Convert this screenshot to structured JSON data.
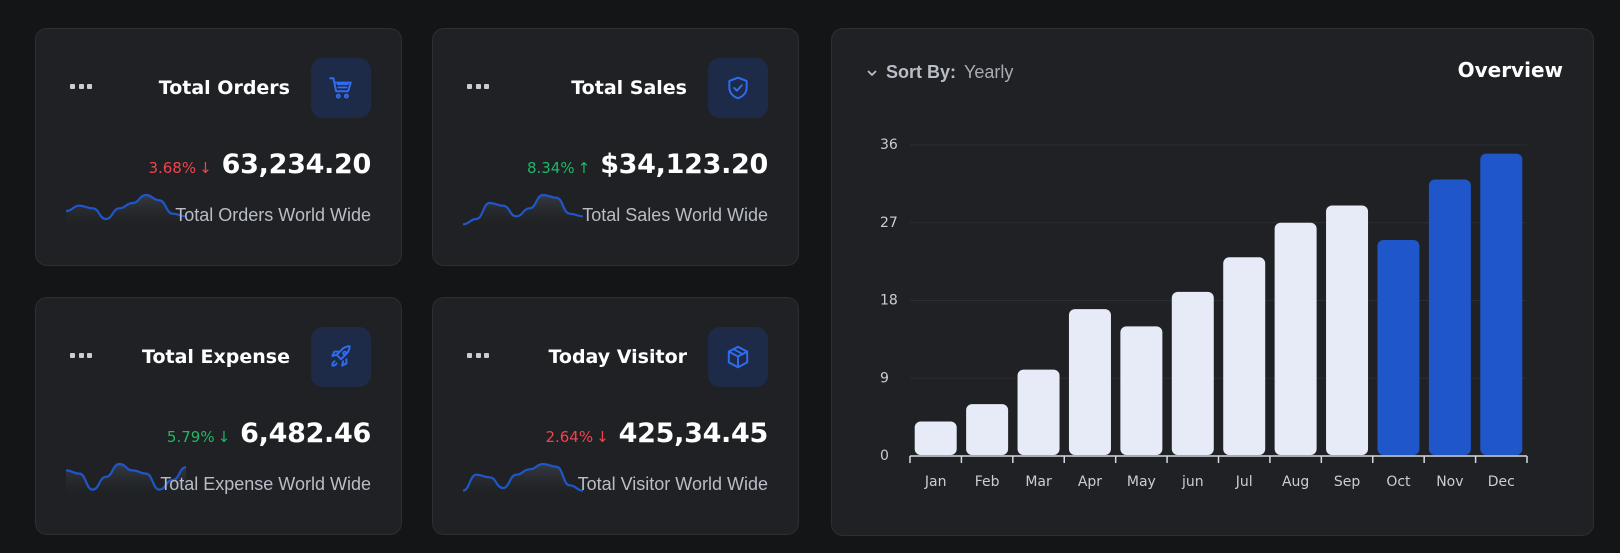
{
  "cards": [
    {
      "title": "Total Orders",
      "icon": "cart-icon",
      "percent": "3.68%",
      "trend": "down",
      "trend_arrow": "↓",
      "value": "63,234.20",
      "subtitle": "Total Orders World Wide",
      "trend_color": "#f1434d",
      "sparkline": [
        6,
        8,
        7,
        3,
        7,
        9,
        12,
        10,
        5,
        4
      ]
    },
    {
      "title": "Total Sales",
      "icon": "shield-check-icon",
      "percent": "8.34%",
      "trend": "up",
      "trend_arrow": "↑",
      "value": "$34,123.20",
      "subtitle": "Total Sales World Wide",
      "trend_color": "#1fb864",
      "sparkline": [
        1,
        3,
        9,
        8,
        4,
        7,
        12,
        11,
        5,
        4
      ]
    },
    {
      "title": "Total Expense",
      "icon": "rocket-icon",
      "percent": "5.79%",
      "trend": "down",
      "trend_arrow": "↓",
      "value": "6,482.46",
      "subtitle": "Total Expense World Wide",
      "trend_color": "#1fb864",
      "sparkline": [
        8,
        7,
        2,
        6,
        10,
        8,
        7,
        2,
        5,
        9
      ]
    },
    {
      "title": "Today Visitor",
      "icon": "box-icon",
      "percent": "2.64%",
      "trend": "down",
      "trend_arrow": "↓",
      "value": "425,34.45",
      "subtitle": "Total Visitor World Wide",
      "trend_color": "#f1434d",
      "sparkline": [
        2,
        8,
        7,
        3,
        8,
        10,
        12,
        11,
        4,
        2
      ]
    }
  ],
  "overview": {
    "title": "Overview",
    "sort_label": "Sort By:",
    "sort_value": "Yearly"
  },
  "chart_data": {
    "type": "bar",
    "categories": [
      "Jan",
      "Feb",
      "Mar",
      "Apr",
      "May",
      "jun",
      "Jul",
      "Aug",
      "Sep",
      "Oct",
      "Nov",
      "Dec"
    ],
    "values": [
      4,
      6,
      10,
      17,
      15,
      19,
      23,
      27,
      29,
      25,
      32,
      35
    ],
    "highlight_indices": [
      9,
      10,
      11
    ],
    "yticks": [
      0,
      9,
      18,
      27,
      36
    ],
    "ylim": [
      0,
      36
    ],
    "grid": true,
    "colors": {
      "default": "#e7ebf7",
      "highlight": "#1f56c9"
    }
  },
  "colors": {
    "accent": "#1f56c9",
    "icon_bg": "#1e2b48",
    "down": "#f1434d",
    "up": "#1fb864"
  }
}
